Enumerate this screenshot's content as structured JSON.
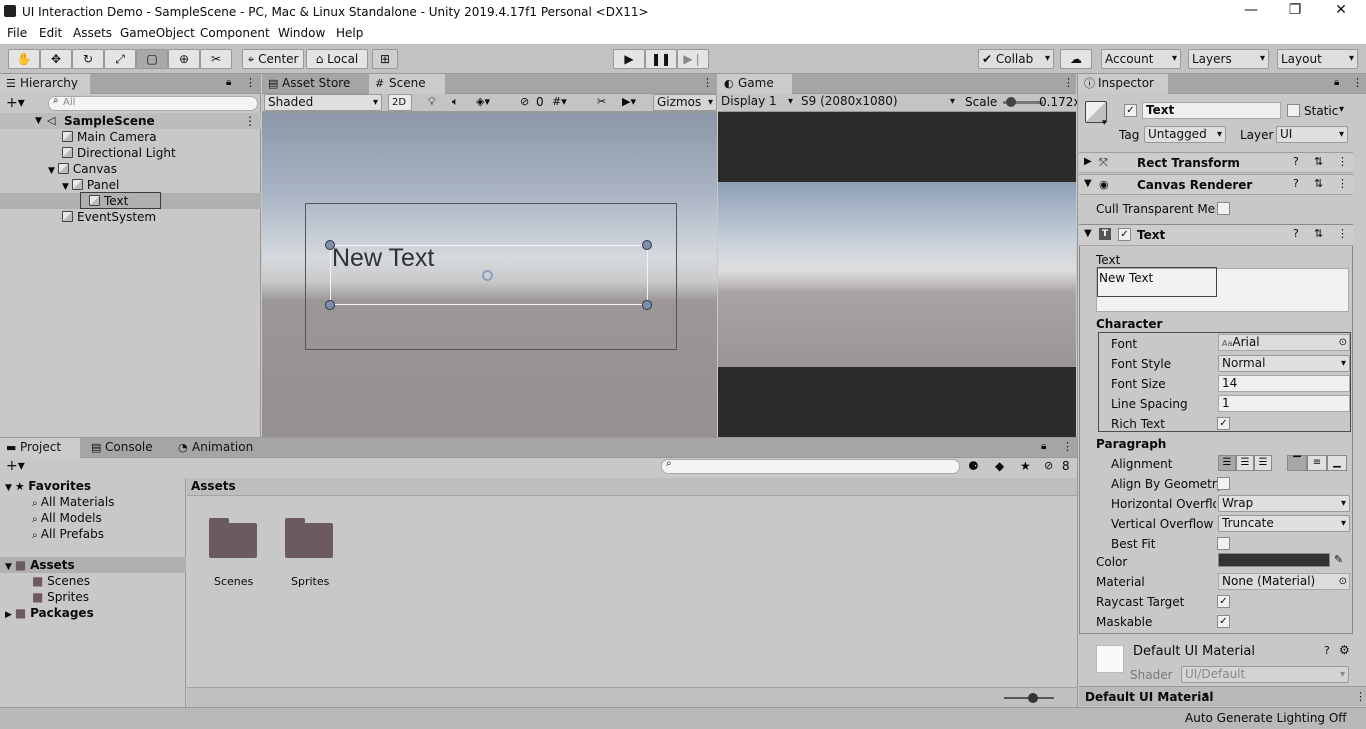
{
  "window": {
    "title": "UI Interaction Demo - SampleScene - PC, Mac & Linux Standalone - Unity 2019.4.17f1 Personal <DX11>",
    "minimize": "—",
    "maximize": "❐",
    "close": "✕"
  },
  "menu": [
    "File",
    "Edit",
    "Assets",
    "GameObject",
    "Component",
    "Window",
    "Help"
  ],
  "toolbar": {
    "pivot": "Center",
    "space": "Local",
    "collab": "Collab",
    "account": "Account",
    "layers": "Layers",
    "layout": "Layout"
  },
  "hierarchy": {
    "tab": "Hierarchy",
    "search_placeholder": "All",
    "scene": "SampleScene",
    "items": [
      "Main Camera",
      "Directional Light",
      "Canvas",
      "Panel",
      "Text",
      "EventSystem"
    ]
  },
  "scene_view": {
    "tab_asset_store": "Asset Store",
    "tab_scene": "Scene",
    "shading": "Shaded",
    "mode_2d": "2D",
    "hidden_count": "0",
    "gizmos": "Gizmos",
    "text_preview": "New Text"
  },
  "game_view": {
    "tab": "Game",
    "display": "Display 1",
    "resolution": "S9 (2080x1080)",
    "scale_label": "Scale",
    "scale_value": "0.172x",
    "scale_level": 0.1
  },
  "inspector": {
    "tab": "Inspector",
    "object_name": "Text",
    "static_label": "Static",
    "tag_label": "Tag",
    "tag_value": "Untagged",
    "layer_label": "Layer",
    "layer_value": "UI",
    "rect_transform": "Rect Transform",
    "canvas_renderer": "Canvas Renderer",
    "cull_label": "Cull Transparent Mes",
    "text_component": "Text",
    "text_label": "Text",
    "text_value": "New Text",
    "character_label": "Character",
    "font_label": "Font",
    "font_value": "Arial",
    "font_icon": "Aa",
    "font_style_label": "Font Style",
    "font_style_value": "Normal",
    "font_size_label": "Font Size",
    "font_size_value": "14",
    "line_spacing_label": "Line Spacing",
    "line_spacing_value": "1",
    "rich_text_label": "Rich Text",
    "paragraph_label": "Paragraph",
    "alignment_label": "Alignment",
    "align_geom_label": "Align By Geometry",
    "h_overflow_label": "Horizontal Overflov",
    "h_overflow_value": "Wrap",
    "v_overflow_label": "Vertical Overflow",
    "v_overflow_value": "Truncate",
    "best_fit_label": "Best Fit",
    "color_label": "Color",
    "material_label": "Material",
    "material_value": "None (Material)",
    "raycast_label": "Raycast Target",
    "maskable_label": "Maskable",
    "default_material": "Default UI Material",
    "shader_label": "Shader",
    "shader_value": "UI/Default",
    "preview_label": "Default UI Material"
  },
  "project": {
    "tab_project": "Project",
    "tab_console": "Console",
    "tab_animation": "Animation",
    "favorites": "Favorites",
    "fav_items": [
      "All Materials",
      "All Models",
      "All Prefabs"
    ],
    "assets": "Assets",
    "asset_children": [
      "Scenes",
      "Sprites"
    ],
    "packages": "Packages",
    "breadcrumb": "Assets",
    "folders": [
      "Scenes",
      "Sprites"
    ],
    "hidden_count": "8",
    "zoom_level": 0.6
  },
  "status": {
    "lighting": "Auto Generate Lighting Off"
  },
  "colors": {
    "selection": "#b0b0b0",
    "text_color_swatch": "#323232"
  }
}
